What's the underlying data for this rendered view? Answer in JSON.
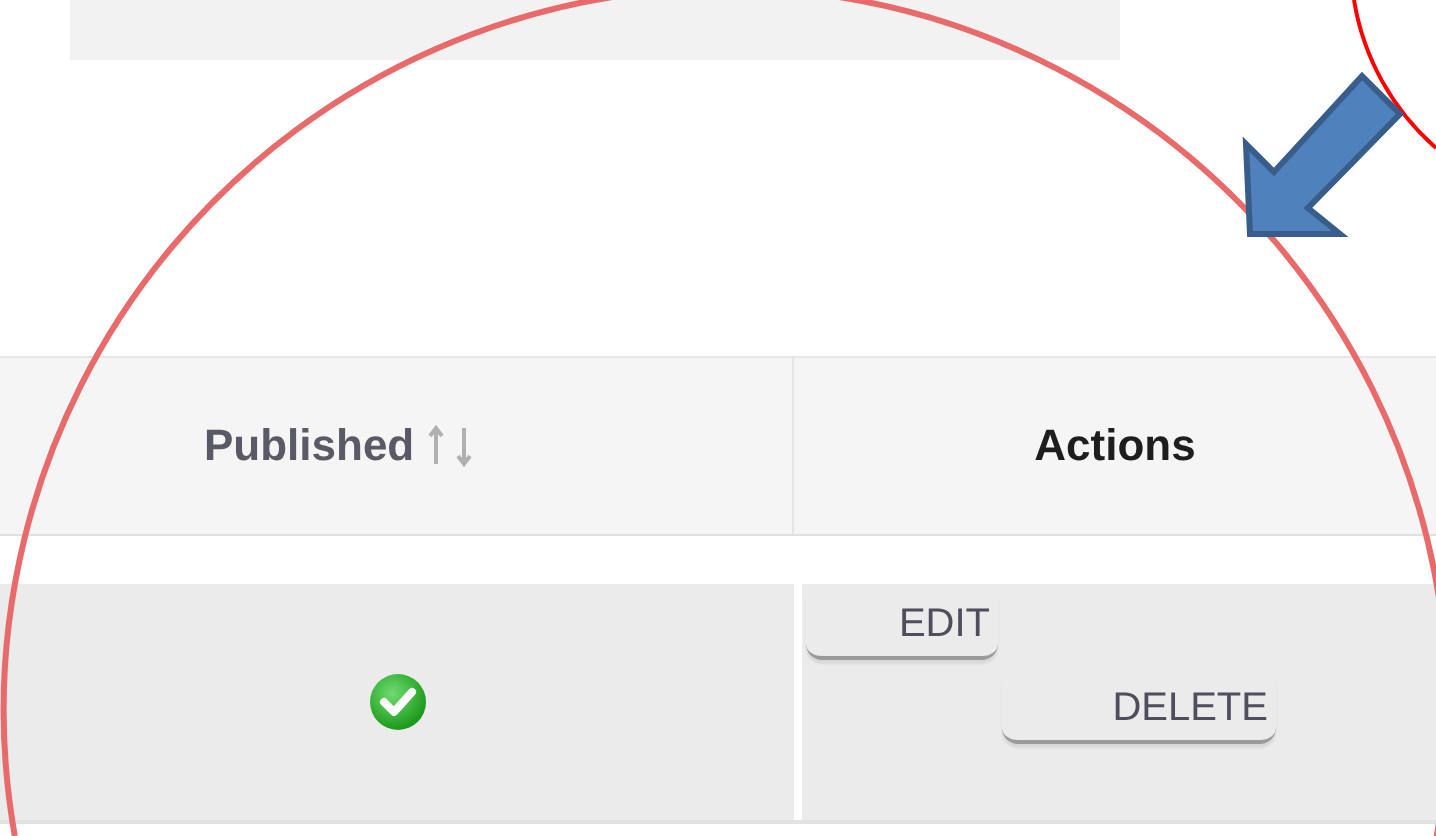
{
  "table": {
    "columns": [
      {
        "label": "Published",
        "sortable": true
      },
      {
        "label": "Actions",
        "sortable": false
      }
    ],
    "rows": [
      {
        "published": true,
        "actions": [
          "EDIT",
          "DELETE"
        ]
      }
    ]
  }
}
